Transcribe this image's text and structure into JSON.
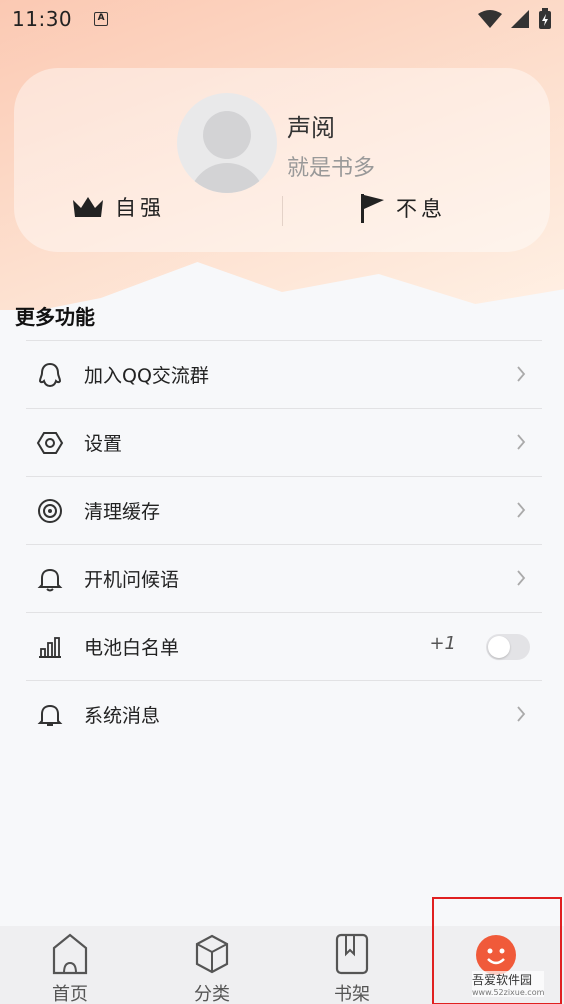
{
  "status_bar": {
    "time": "11:30",
    "notif_icon": "A"
  },
  "profile": {
    "name": "声阅",
    "subtitle": "就是书多",
    "stat_left_label": "自强",
    "stat_right_label": "不息"
  },
  "more": {
    "title": "更多功能",
    "items": [
      {
        "label": "加入QQ交流群",
        "icon": "qq-icon"
      },
      {
        "label": "设置",
        "icon": "hexagon-settings-icon"
      },
      {
        "label": "清理缓存",
        "icon": "target-icon"
      },
      {
        "label": "开机问候语",
        "icon": "bell-icon"
      },
      {
        "label": "电池白名单",
        "icon": "bar-chart-icon",
        "badge": "+1",
        "toggle_on": false
      },
      {
        "label": "系统消息",
        "icon": "bell-icon"
      }
    ]
  },
  "bottom_nav": {
    "items": [
      {
        "label": "首页"
      },
      {
        "label": "分类"
      },
      {
        "label": "书架"
      }
    ],
    "watermark": "吾爱软件园",
    "watermark_url": "www.52zixue.com"
  },
  "colors": {
    "accent": "#f05a3a",
    "hero_start": "#fbc9b3",
    "highlight_border": "#e02020"
  }
}
